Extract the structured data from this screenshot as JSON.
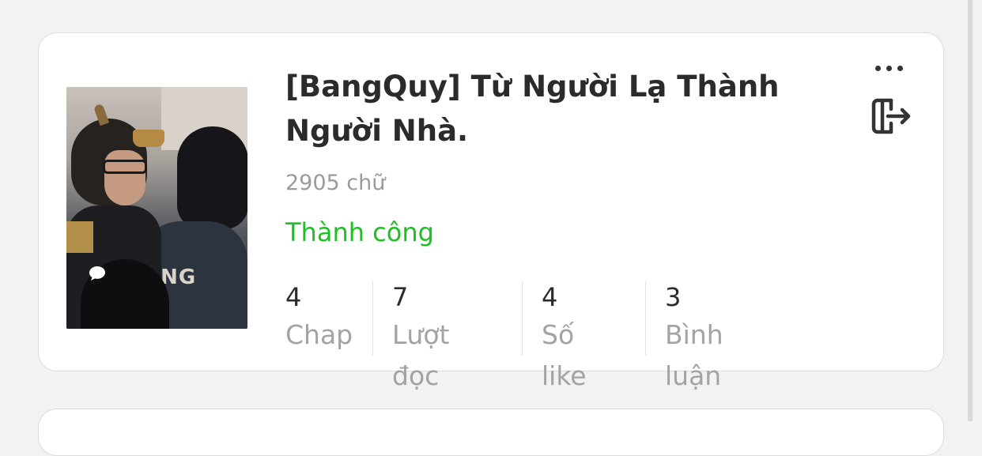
{
  "story": {
    "title": "[BangQuy] Từ Người Lạ Thành Người Nhà.",
    "word_count": "2905 chữ",
    "status": "Thành công",
    "status_color": "#19c21f",
    "cover_jersey_text": "ANG",
    "stats": [
      {
        "value": "4",
        "label": "Chap"
      },
      {
        "value": "7",
        "label": "Lượt đọc"
      },
      {
        "value": "4",
        "label": "Số like"
      },
      {
        "value": "3",
        "label": "Bình luận"
      }
    ]
  },
  "actions": {
    "more_icon": "more-horizontal-icon",
    "exit_icon": "exit-icon"
  }
}
